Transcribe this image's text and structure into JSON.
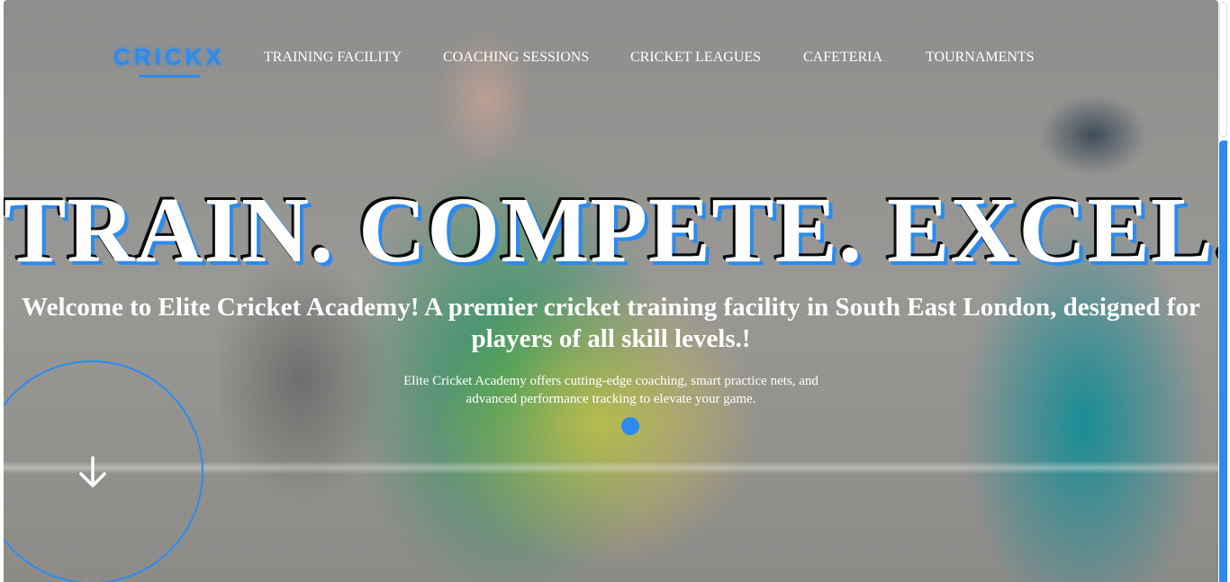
{
  "brand": {
    "logo_text": "CRICKX",
    "accent_color": "#2b8bf0"
  },
  "nav": {
    "items": [
      {
        "label": "TRAINING FACILITY"
      },
      {
        "label": "COACHING SESSIONS"
      },
      {
        "label": "CRICKET LEAGUES"
      },
      {
        "label": "CAFETERIA"
      },
      {
        "label": "TOURNAMENTS"
      }
    ]
  },
  "hero": {
    "headline": "TRAIN. COMPETE. EXCEL.",
    "subheadline": "Welcome to Elite Cricket Academy! A premier cricket training facility in South East London, designed for players of all skill levels.!",
    "description": "Elite Cricket Academy offers cutting-edge coaching, smart practice nets, and advanced performance tracking to elevate your game.",
    "scroll_icon": "arrow-down-icon",
    "indicator_icon": "dot-indicator"
  }
}
